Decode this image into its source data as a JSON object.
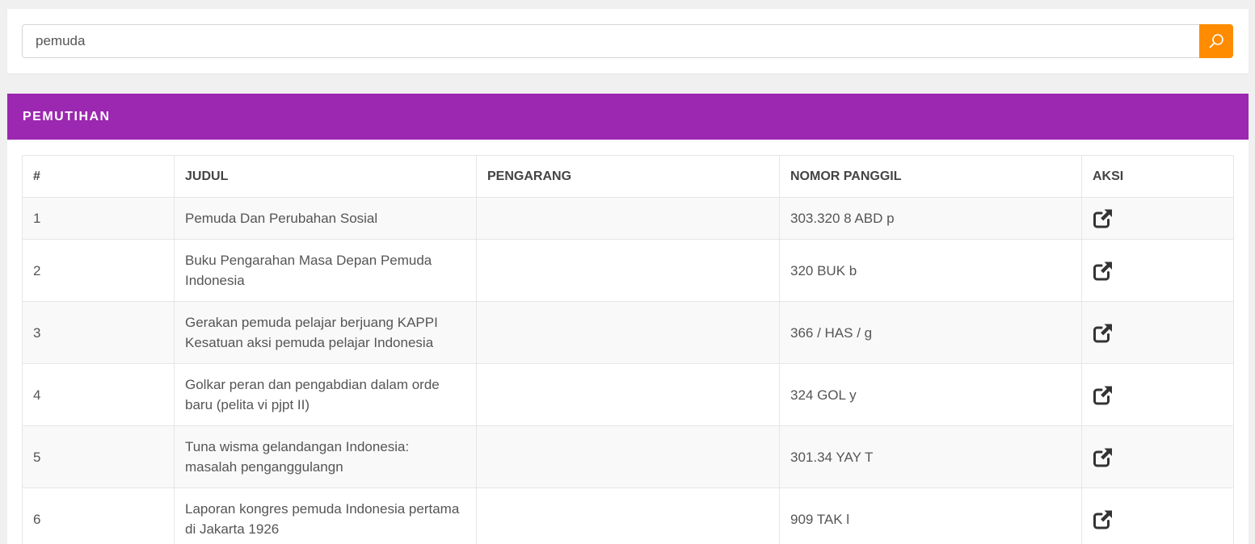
{
  "search": {
    "value": "pemuda",
    "button_icon": "search-icon"
  },
  "panel": {
    "title": "PEMUTIHAN"
  },
  "colors": {
    "accent": "#ff8c00",
    "panel_header": "#9c27b0",
    "text": "#555555"
  },
  "table": {
    "columns": [
      "#",
      "JUDUL",
      "PENGARANG",
      "NOMOR PANGGIL",
      "AKSI"
    ],
    "action_icon": "external-link-icon",
    "rows": [
      {
        "no": "1",
        "judul": "Pemuda Dan Perubahan Sosial",
        "pengarang": "",
        "nomor_panggil": "303.320 8 ABD p"
      },
      {
        "no": "2",
        "judul": "Buku Pengarahan Masa Depan Pemuda Indonesia",
        "pengarang": "",
        "nomor_panggil": "320 BUK b"
      },
      {
        "no": "3",
        "judul": "Gerakan pemuda pelajar berjuang KAPPI Kesatuan aksi pemuda pelajar Indonesia",
        "pengarang": "",
        "nomor_panggil": "366 / HAS / g"
      },
      {
        "no": "4",
        "judul": "Golkar peran dan pengabdian dalam orde baru (pelita vi pjpt II)",
        "pengarang": "",
        "nomor_panggil": "324 GOL y"
      },
      {
        "no": "5",
        "judul": "Tuna wisma gelandangan Indonesia: masalah penganggulangn",
        "pengarang": "",
        "nomor_panggil": "301.34 YAY T"
      },
      {
        "no": "6",
        "judul": "Laporan kongres pemuda Indonesia pertama di Jakarta 1926",
        "pengarang": "",
        "nomor_panggil": "909 TAK l"
      }
    ]
  }
}
